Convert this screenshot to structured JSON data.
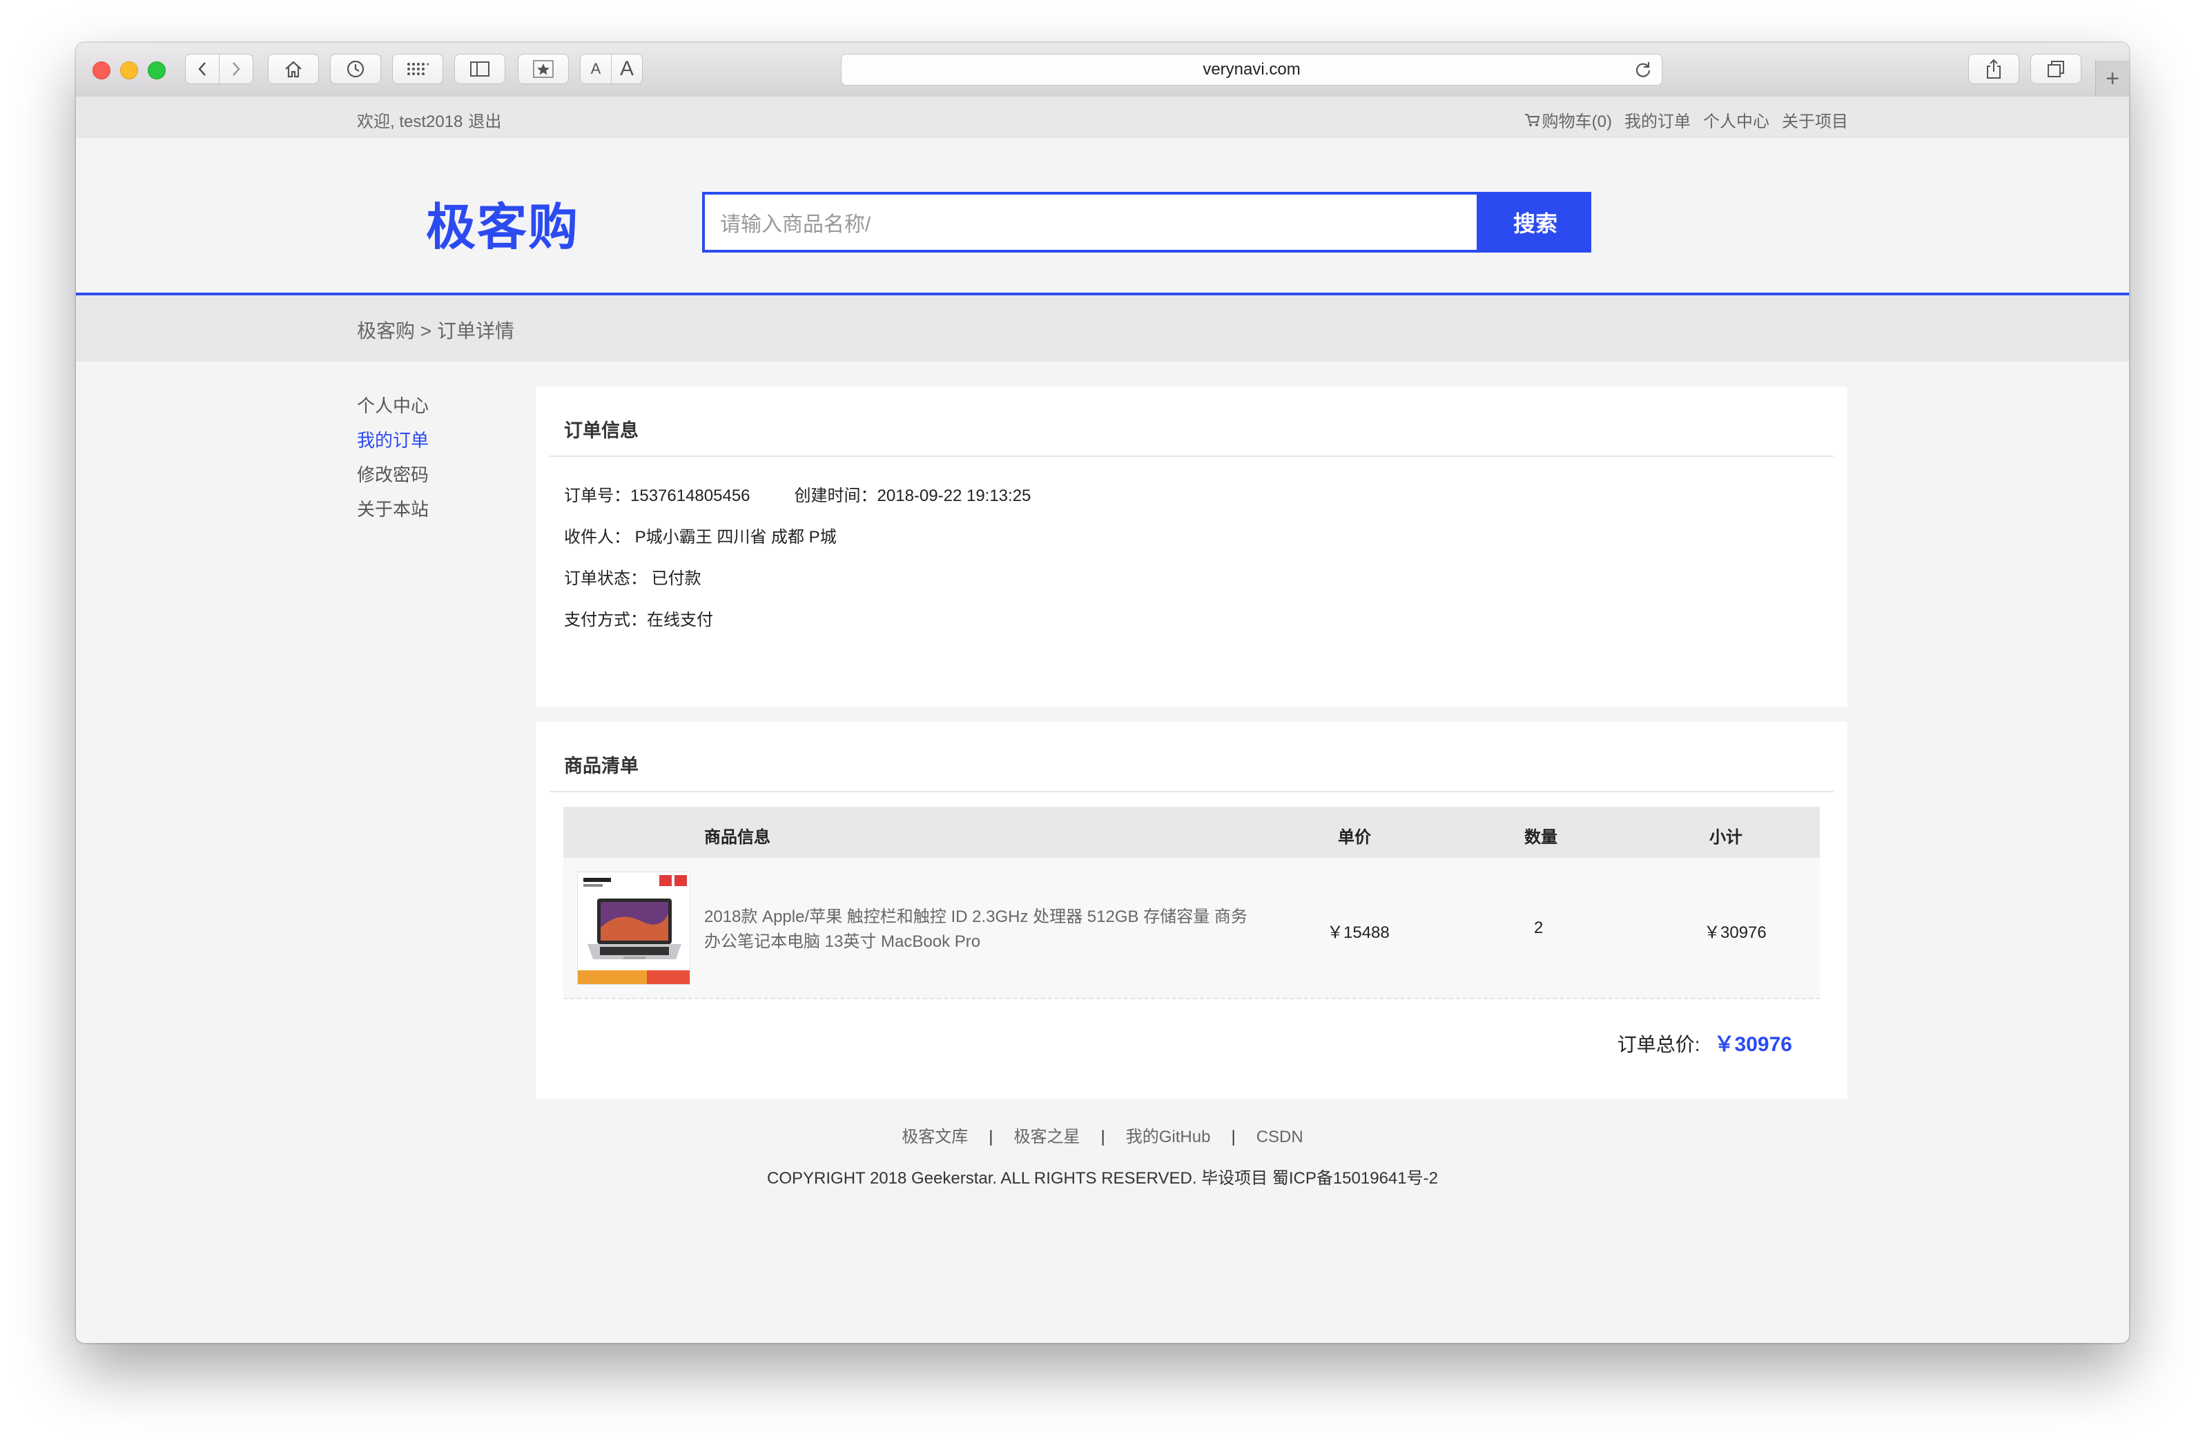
{
  "browser": {
    "url": "verynavi.com"
  },
  "topbar": {
    "welcome": "欢迎, test2018",
    "logout": "退出",
    "cart": "购物车(0)",
    "my_orders": "我的订单",
    "personal_center": "个人中心",
    "about_project": "关于项目"
  },
  "header": {
    "logo": "极客购",
    "search_placeholder": "请输入商品名称/",
    "search_button": "搜索"
  },
  "breadcrumb": {
    "home": "极客购",
    "separator": ">",
    "current": "订单详情"
  },
  "sidenav": {
    "items": [
      {
        "label": "个人中心",
        "active": false
      },
      {
        "label": "我的订单",
        "active": true
      },
      {
        "label": "修改密码",
        "active": false
      },
      {
        "label": "关于本站",
        "active": false
      }
    ]
  },
  "order_info": {
    "title": "订单信息",
    "order_no_label": "订单号：",
    "order_no": "1537614805456",
    "created_label": "创建时间：",
    "created": "2018-09-22 19:13:25",
    "receiver_label": "收件人：",
    "receiver": "P城小霸王 四川省 成都 P城",
    "status_label": "订单状态：",
    "status": "已付款",
    "payment_label": "支付方式：",
    "payment": "在线支付"
  },
  "goods": {
    "title": "商品清单",
    "columns": [
      "商品信息",
      "单价",
      "数量",
      "小计"
    ],
    "items": [
      {
        "name": "2018款 Apple/苹果 触控栏和触控 ID 2.3GHz 处理器 512GB 存储容量 商务办公笔记本电脑 13英寸 MacBook Pro",
        "price": "￥15488",
        "quantity": "2",
        "subtotal": "￥30976"
      }
    ],
    "total_label": "订单总价:",
    "total": "￥30976"
  },
  "footer": {
    "links": [
      "极客文库",
      "极客之星",
      "我的GitHub",
      "CSDN"
    ],
    "separator": "|",
    "copyright": "COPYRIGHT 2018 Geekerstar. ALL RIGHTS RESERVED. 毕设项目 蜀ICP备15019641号-2"
  },
  "colors": {
    "accent": "#2b4bf0"
  }
}
